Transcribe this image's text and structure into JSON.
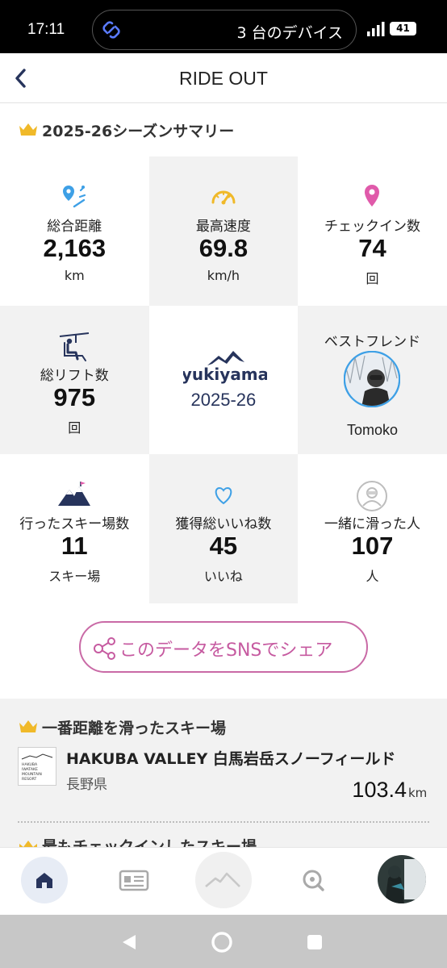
{
  "status_bar": {
    "time": "17:11",
    "devices": "3 台のデバイス",
    "battery": "41"
  },
  "header": {
    "title": "RIDE OUT"
  },
  "summary": {
    "title": "2025-26シーズンサマリー",
    "stats": {
      "distance": {
        "label": "総合距離",
        "value": "2,163",
        "unit": "km",
        "icon": "map-pin-ski-icon"
      },
      "top_speed": {
        "label": "最高速度",
        "value": "69.8",
        "unit": "km/h",
        "icon": "speedometer-icon"
      },
      "checkins": {
        "label": "チェックイン数",
        "value": "74",
        "unit": "回",
        "icon": "location-pin-icon"
      },
      "lifts": {
        "label": "総リフト数",
        "value": "975",
        "unit": "回",
        "icon": "chairlift-icon"
      },
      "resorts": {
        "label": "行ったスキー場数",
        "value": "11",
        "unit": "スキー場",
        "icon": "mountain-icon"
      },
      "likes": {
        "label": "獲得総いいね数",
        "value": "45",
        "unit": "いいね",
        "icon": "heart-icon"
      },
      "companions": {
        "label": "一緒に滑った人",
        "value": "107",
        "unit": "人",
        "icon": "person-icon"
      }
    },
    "brand": {
      "logo_text": "yukiyama",
      "season": "2025-26"
    },
    "best_friend": {
      "label": "ベストフレンド",
      "name": "Tomoko"
    }
  },
  "share_button": {
    "label": "このデータをSNSでシェア"
  },
  "top_resort": {
    "title": "一番距離を滑ったスキー場",
    "logo_lines": [
      "HAKUBA",
      "IWATAKE",
      "MOUNTAIN",
      "RESORT"
    ],
    "name": "HAKUBA VALLEY 白馬岩岳スノーフィールド",
    "prefecture": "長野県",
    "distance": "103.4",
    "unit": "km"
  },
  "next_section": {
    "title": "最もチェックインしたスキー場"
  },
  "colors": {
    "accent_navy": "#27345c",
    "share_pink": "#c65aa0",
    "crown_gold": "#f0b929",
    "cell_gray": "#f2f2f2"
  }
}
